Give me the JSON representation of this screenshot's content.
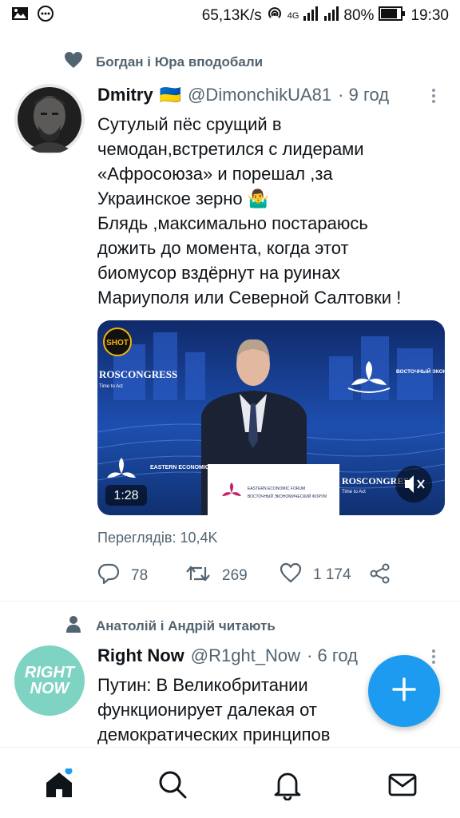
{
  "status_bar": {
    "network_speed": "65,13K/s",
    "network_type": "4G",
    "battery": "80%",
    "time": "19:30",
    "icons": [
      "image-icon",
      "message-icon",
      "hotspot-icon",
      "signal-icon",
      "battery-icon"
    ]
  },
  "tweets": [
    {
      "social_context": "Богдан і Юра вподобали",
      "social_icon": "heart-icon",
      "display_name": "Dmitry",
      "flag": "🇺🇦",
      "handle": "@DimonchikUA81",
      "time": "· 9 год",
      "text_lines": [
        "Сутулый пёс срущий в",
        "чемодан,встретился с лидерами",
        "«Афросоюза» и порешал ,за",
        "Украинское зерно 🤷‍♂",
        "Блядь ,максимально постараюсь",
        "дожить до момента, когда этот",
        "биомусор вздёрнут на руинах",
        "Мариуполя или Северной Салтовки !"
      ],
      "media": {
        "shot_badge": "SHOT",
        "duration": "1:28",
        "brand_left": "ROSCONGRESS",
        "brand_left_sub": "Time to Act",
        "brand_right": "ROSCONGRESS",
        "brand_right_sub": "Time to Act",
        "forum_ru": "ВОСТОЧНЫЙ ЭКОНОМИЧЕСКИЙ ФОРУМ",
        "forum_en": "EASTERN ECONOMIC FORUM",
        "podium_en": "EASTERN ECONOMIC FORUM",
        "podium_ru": "ВОСТОЧНЫЙ ЭКОНОМИЧЕСКИЙ ФОРУМ"
      },
      "views": "Переглядів: 10,4K",
      "replies": "78",
      "retweets": "269",
      "likes": "1 174"
    },
    {
      "social_context": "Анатолій і Андрій читають",
      "social_icon": "person-icon",
      "display_name": "Right Now",
      "handle": "@R1ght_Now",
      "time": "· 6 год",
      "avatar_text": [
        "RIGHT",
        "NOW"
      ],
      "text_lines": [
        "Путин: В Великобритании",
        "функционирует далекая от",
        "демократических принципов"
      ]
    }
  ],
  "colors": {
    "accent": "#1d9bf0",
    "secondary_text": "#536471",
    "avatar_green": "#7ed3c3"
  },
  "bottom_nav": [
    "home-icon",
    "search-icon",
    "notifications-icon",
    "messages-icon"
  ]
}
